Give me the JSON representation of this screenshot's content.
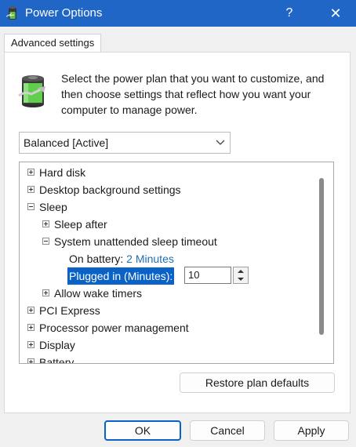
{
  "window": {
    "title": "Power Options",
    "help_label": "?",
    "close_label": "✕",
    "accent_color": "#1f66c6"
  },
  "tabs": [
    {
      "label": "Advanced settings"
    }
  ],
  "description": "Select the power plan that you want to customize, and then choose settings that reflect how you want your computer to manage power.",
  "plan_select": {
    "value": "Balanced [Active]"
  },
  "tree": {
    "items": [
      {
        "label": "Hard disk"
      },
      {
        "label": "Desktop background settings"
      },
      {
        "label": "Sleep"
      },
      {
        "label": "Sleep after"
      },
      {
        "label": "System unattended sleep timeout"
      },
      {
        "label": "On battery:",
        "value": "2 Minutes"
      },
      {
        "label": "Plugged in (Minutes):",
        "value": "10"
      },
      {
        "label": "Allow wake timers"
      },
      {
        "label": "PCI Express"
      },
      {
        "label": "Processor power management"
      },
      {
        "label": "Display"
      },
      {
        "label": "Battery"
      }
    ],
    "selection_color": "#0a62c7"
  },
  "buttons": {
    "restore": "Restore plan defaults",
    "ok": "OK",
    "cancel": "Cancel",
    "apply": "Apply"
  }
}
